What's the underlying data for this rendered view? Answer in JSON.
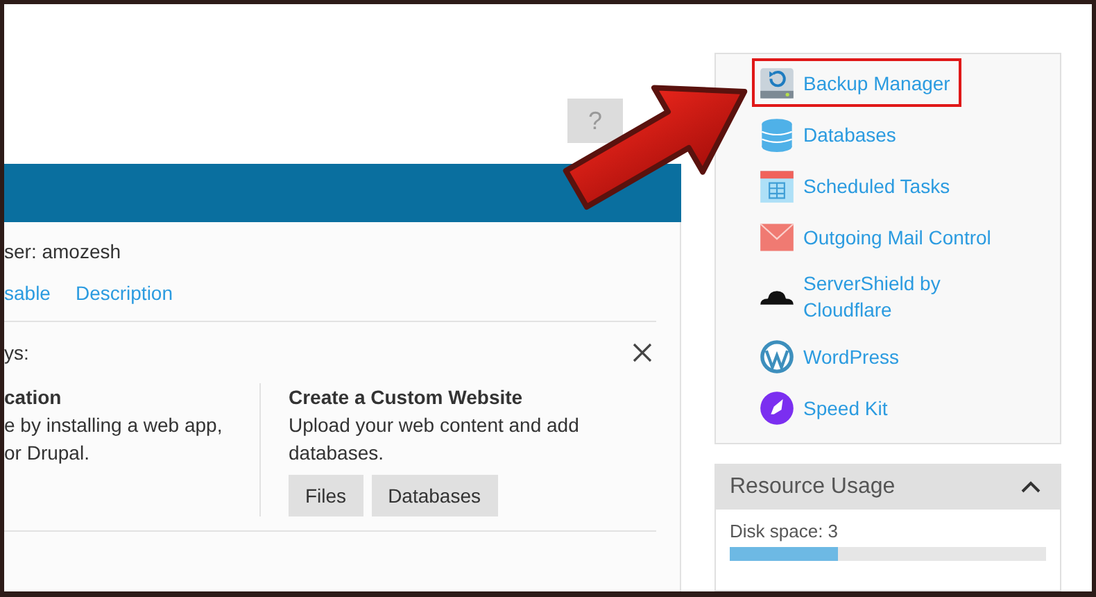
{
  "help_button": {
    "label": "?"
  },
  "panel": {
    "owner": "ser: amozesh",
    "links": [
      "sable",
      "Description"
    ],
    "section_title": "ys:",
    "options": [
      {
        "title": "cation",
        "lines": [
          "e by installing a web app,",
          "or Drupal."
        ]
      },
      {
        "title": "Create a Custom Website",
        "lines": [
          "Upload your web content and add databases."
        ],
        "buttons": [
          "Files",
          "Databases"
        ]
      }
    ]
  },
  "sidebar": {
    "items": [
      {
        "kind": "backup",
        "label": "Backup Manager",
        "highlighted": true
      },
      {
        "kind": "databases",
        "label": "Databases",
        "highlighted": false
      },
      {
        "kind": "scheduled",
        "label": "Scheduled Tasks",
        "highlighted": false
      },
      {
        "kind": "mail",
        "label": "Outgoing Mail Control",
        "highlighted": false
      },
      {
        "kind": "cloud",
        "label": "ServerShield by Cloudflare",
        "highlighted": false
      },
      {
        "kind": "wordpress",
        "label": "WordPress",
        "highlighted": false
      },
      {
        "kind": "speedkit",
        "label": "Speed Kit",
        "highlighted": false
      }
    ]
  },
  "resource_usage": {
    "title": "Resource Usage",
    "expanded": true,
    "disk_label": "Disk space: 3",
    "level": 0.34
  }
}
